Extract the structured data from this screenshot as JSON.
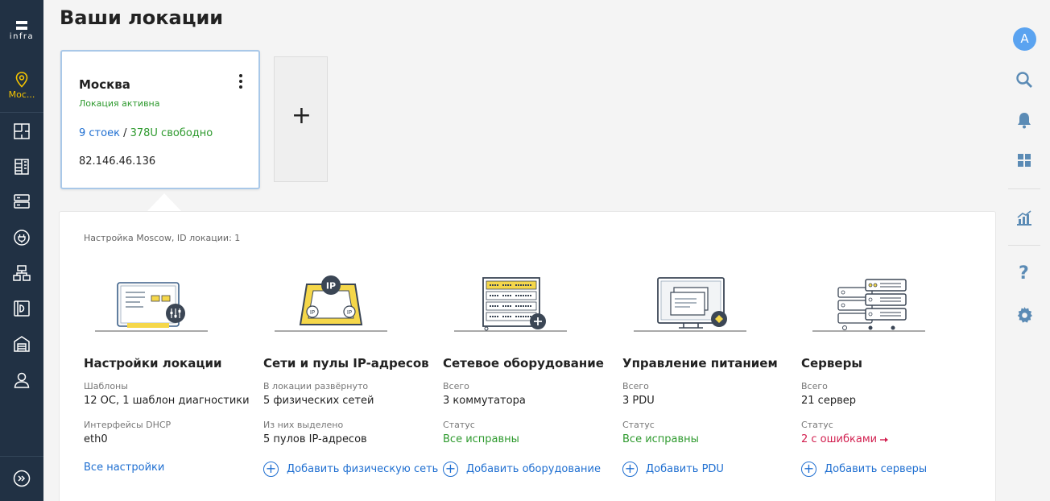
{
  "app": {
    "logo_text": "infra"
  },
  "sidebar": {
    "location_label": "Мос...",
    "items": [
      {
        "icon": "floor-plan-icon"
      },
      {
        "icon": "rack-icon"
      },
      {
        "icon": "server-icon"
      },
      {
        "icon": "power-icon"
      },
      {
        "icon": "network-icon"
      },
      {
        "icon": "storage-icon"
      },
      {
        "icon": "warehouse-icon"
      },
      {
        "icon": "user-icon"
      }
    ],
    "bottom_icon": "expand-icon"
  },
  "rightbar": {
    "avatar_letter": "A",
    "help_glyph": "?"
  },
  "page": {
    "title": "Ваши локации"
  },
  "location_card": {
    "name": "Москва",
    "status": "Локация активна",
    "racks": "9 стоек",
    "separator": " / ",
    "free": "378U свободно",
    "ip": "82.146.46.136"
  },
  "add_card": {
    "symbol": "+"
  },
  "panel": {
    "subtitle": "Настройка Moscow, ID локации: 1",
    "columns": [
      {
        "title": "Настройки локации",
        "label1": "Шаблоны",
        "value1": "12 ОС, 1 шаблон диагностики",
        "label2": "Интерфейсы DHCP",
        "value2": "eth0",
        "action": "Все настройки"
      },
      {
        "title": "Сети и пулы IP-адресов",
        "label1": "В локации развёрнуто",
        "value1": "5 физических сетей",
        "label2": "Из них выделено",
        "value2": "5 пулов IP-адресов",
        "action": "Добавить физическую сеть"
      },
      {
        "title": "Сетевое оборудование",
        "label1": "Всего",
        "value1": "3 коммутатора",
        "label2": "Статус",
        "value2": "Все исправны",
        "action": "Добавить оборудование"
      },
      {
        "title": "Управление питанием",
        "label1": "Всего",
        "value1": "3 PDU",
        "label2": "Статус",
        "value2": "Все исправны",
        "action": "Добавить PDU"
      },
      {
        "title": "Серверы",
        "label1": "Всего",
        "value1": "21 сервер",
        "label2": "Статус",
        "value2": "2 с ошибками",
        "action": "Добавить серверы"
      }
    ]
  },
  "colors": {
    "sidebar_bg": "#213144",
    "accent_yellow": "#f5c400",
    "link_blue": "#1f6fd1",
    "ok_green": "#2e9a2e",
    "error_red": "#d21f4f"
  }
}
